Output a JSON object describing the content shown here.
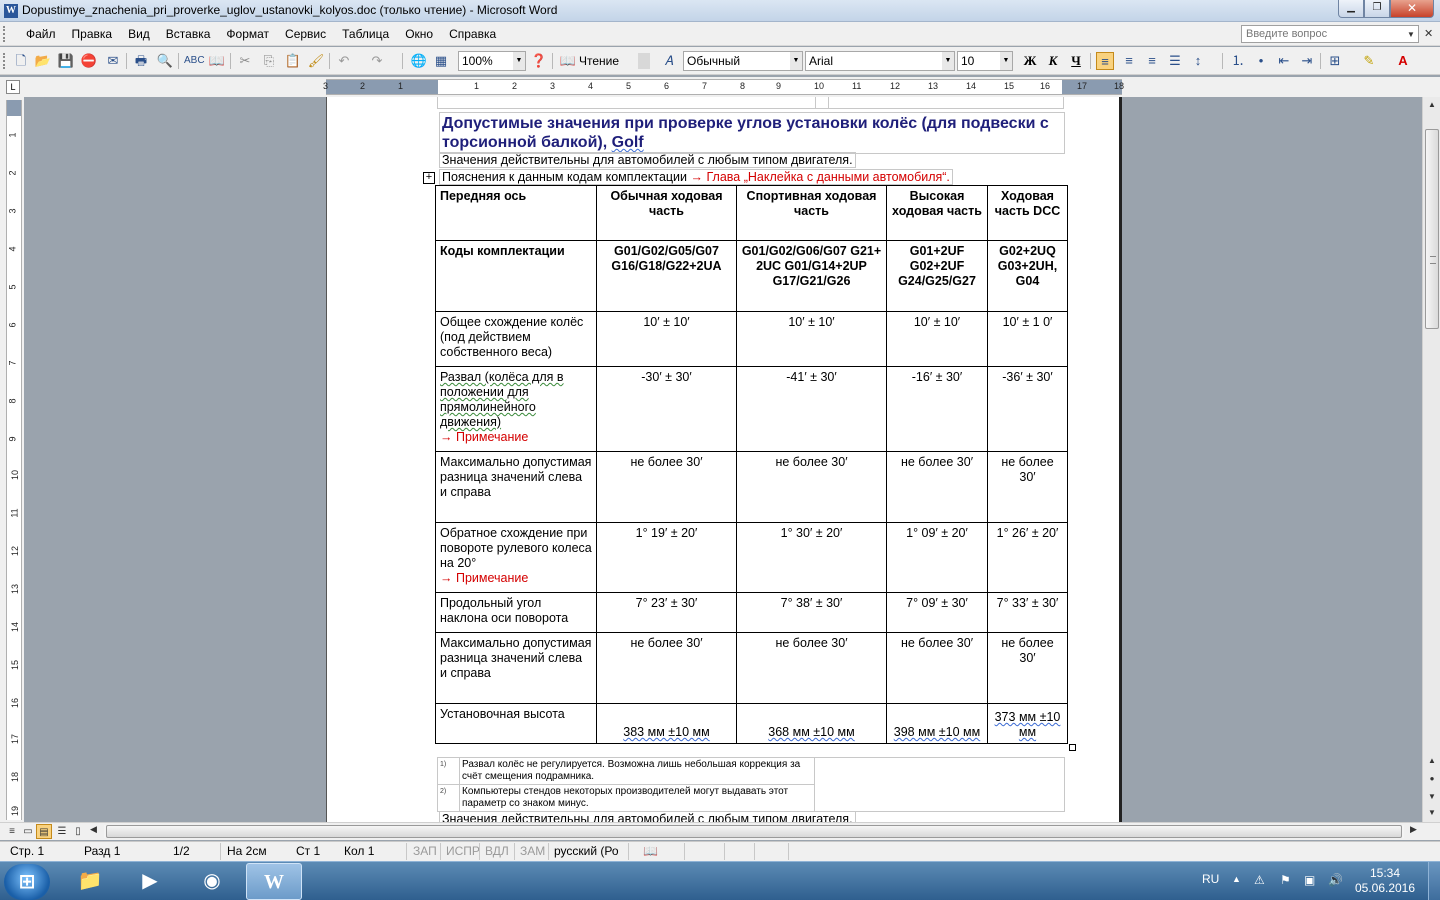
{
  "window": {
    "title": "Dopustimye_znachenia_pri_proverke_uglov_ustanovki_kolyos.doc (только чтение) - Microsoft Word",
    "app_icon": "word-icon"
  },
  "menu": {
    "items": [
      "Файл",
      "Правка",
      "Вид",
      "Вставка",
      "Формат",
      "Сервис",
      "Таблица",
      "Окно",
      "Справка"
    ],
    "help_placeholder": "Введите вопрос"
  },
  "toolbar": {
    "zoom": "100%",
    "reading_label": "Чтение",
    "style": "Обычный",
    "font": "Arial",
    "font_size": "10",
    "bold_label": "Ж",
    "italic_label": "К",
    "underline_label": "Ч",
    "icons": [
      "new-icon",
      "open-icon",
      "save-icon",
      "permission-icon",
      "print-icon",
      "print-preview-icon",
      "spelling-icon",
      "research-icon",
      "cut-icon",
      "copy-icon",
      "paste-icon",
      "format-painter-icon",
      "undo-icon",
      "redo-icon",
      "hyperlink-icon",
      "table-icon",
      "help-icon",
      "styles-icon",
      "align-left-icon",
      "align-center-icon",
      "align-right-icon",
      "justify-icon",
      "line-spacing-icon",
      "numbering-icon",
      "bullets-icon",
      "decrease-indent-icon",
      "increase-indent-icon",
      "borders-icon",
      "highlight-icon",
      "font-color-icon"
    ]
  },
  "ruler": {
    "numbers": [
      "3",
      "2",
      "1",
      "1",
      "2",
      "3",
      "4",
      "5",
      "6",
      "7",
      "8",
      "9",
      "10",
      "11",
      "12",
      "13",
      "14",
      "15",
      "16",
      "17",
      "18"
    ],
    "v_numbers": [
      "1",
      "2",
      "3",
      "4",
      "5",
      "6",
      "7",
      "8",
      "9",
      "10",
      "11",
      "12",
      "13",
      "14",
      "15",
      "16",
      "17",
      "18",
      "19"
    ]
  },
  "document": {
    "heading_part1": "Допустимые значения при проверке углов установки колёс (для подвески с торсионной балкой), ",
    "heading_golf": "Golf",
    "note1": "Значения действительны для автомобилей с любым типом двигателя.",
    "note2_prefix": "Пояснения к данным кодам комплектации ",
    "note2_link": "→ Глава „Наклейка с данными автомобиля“.",
    "table": {
      "header": [
        "Передняя ось",
        "Обычная ходовая часть",
        "Спортивная ходовая часть",
        "Высокая ходовая часть",
        "Ходовая часть DCC"
      ],
      "codes_label": "Коды комплектации",
      "codes": [
        "G01/G02/G05/G07 G16/G18/G22+2UA",
        "G01/G02/G06/G07 G21+ 2UC G01/G14+2UP G17/G21/G26",
        "G01+2UF G02+2UF G24/G25/G27",
        "G02+2UQ G03+2UH, G04"
      ],
      "rows": [
        {
          "label": "Общее схождение колёс (под действием собственного веса)",
          "values": [
            "10′ ± 10′",
            "10′ ± 10′",
            "10′ ± 10′",
            "10′ ± 1 0′"
          ]
        },
        {
          "label": "Развал (колёса для в положении для прямолинейного движения)",
          "link": "→ Примечание",
          "values": [
            "-30′ ± 30′",
            "-41′ ± 30′",
            "-16′ ± 30′",
            "-36′ ± 30′"
          ]
        },
        {
          "label": "Максимально допустимая разница значений слева и справа",
          "values": [
            "не более 30′",
            "не более 30′",
            "не более 30′",
            "не более 30′"
          ]
        },
        {
          "label": "Обратное схождение при повороте рулевого колеса на 20°",
          "link": "→ Примечание",
          "values": [
            "1° 19′ ± 20′",
            "1° 30′ ± 20′",
            "1° 09′ ± 20′",
            "1° 26′ ± 20′"
          ]
        },
        {
          "label": "Продольный угол наклона оси поворота",
          "values": [
            "7° 23′ ± 30′",
            "7° 38′ ± 30′",
            "7° 09′ ± 30′",
            "7° 33′ ± 30′"
          ]
        },
        {
          "label": "Максимально допустимая разница значений слева и справа",
          "values": [
            "не более 30′",
            "не более 30′",
            "не более 30′",
            "не более 30′"
          ]
        },
        {
          "label": "Установочная высота",
          "values": [
            "383 мм ±10 мм",
            "368 мм ±10 мм",
            "398 мм ±10 мм",
            "373 мм ±10 мм"
          ]
        }
      ]
    },
    "footnotes": [
      {
        "mark": "1)",
        "text": "Развал колёс не регулируется. Возможна лишь небольшая коррекция за счёт смещения подрамника."
      },
      {
        "mark": "2)",
        "text": "Компьютеры стендов некоторых производителей могут выдавать этот параметр со знаком минус."
      }
    ],
    "last_line": "Значения действительны для автомобилей с любым типом двигателя."
  },
  "status": {
    "page": "Стр. 1",
    "section": "Разд 1",
    "pages": "1/2",
    "at": "На 2см",
    "line": "Ст 1",
    "col": "Кол 1",
    "rec": "ЗАП",
    "trk": "ИСПР",
    "ext": "ВДЛ",
    "ovr": "ЗАМ",
    "language": "русский (Ро"
  },
  "taskbar": {
    "lang": "RU",
    "time": "15:34",
    "date": "05.06.2016"
  }
}
